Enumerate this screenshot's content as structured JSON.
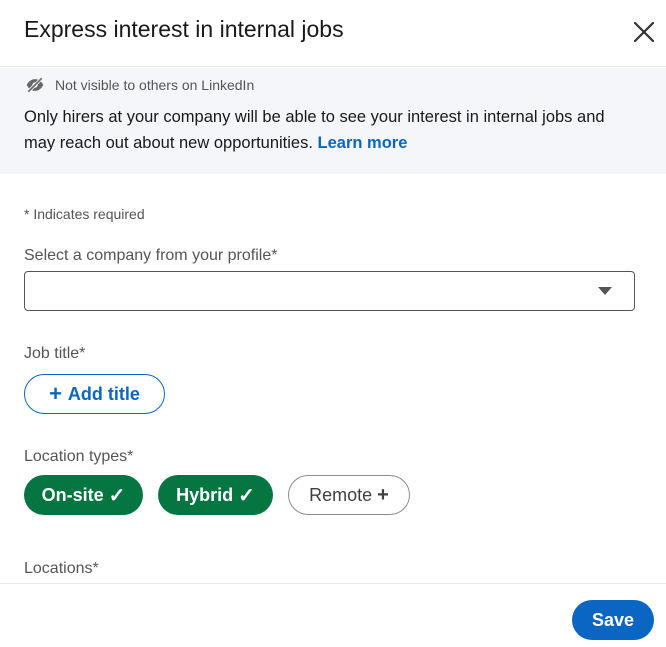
{
  "dialog": {
    "title": "Express interest in internal jobs",
    "close_icon": "close-icon"
  },
  "notice": {
    "icon": "eye-slash-icon",
    "label": "Not visible to others on LinkedIn",
    "body": "Only hirers at your company will be able to see your interest in internal jobs and may reach out about new opportunities.",
    "link": "Learn more"
  },
  "form": {
    "required_note": "* Indicates required",
    "company": {
      "label": "Select a company from your profile*",
      "value": ""
    },
    "job_title": {
      "label": "Job title*",
      "add_button": "Add title",
      "add_icon": "plus-icon"
    },
    "location_types": {
      "label": "Location types*",
      "options": [
        {
          "label": "On-site",
          "selected": true,
          "glyph": "✓"
        },
        {
          "label": "Hybrid",
          "selected": true,
          "glyph": "✓"
        },
        {
          "label": "Remote",
          "selected": false,
          "glyph": "+"
        }
      ]
    },
    "locations": {
      "label": "Locations*"
    }
  },
  "footer": {
    "save_label": "Save"
  },
  "colors": {
    "accent": "#0a66c2",
    "selected": "#057642",
    "notice_bg": "#f4f6f9"
  }
}
